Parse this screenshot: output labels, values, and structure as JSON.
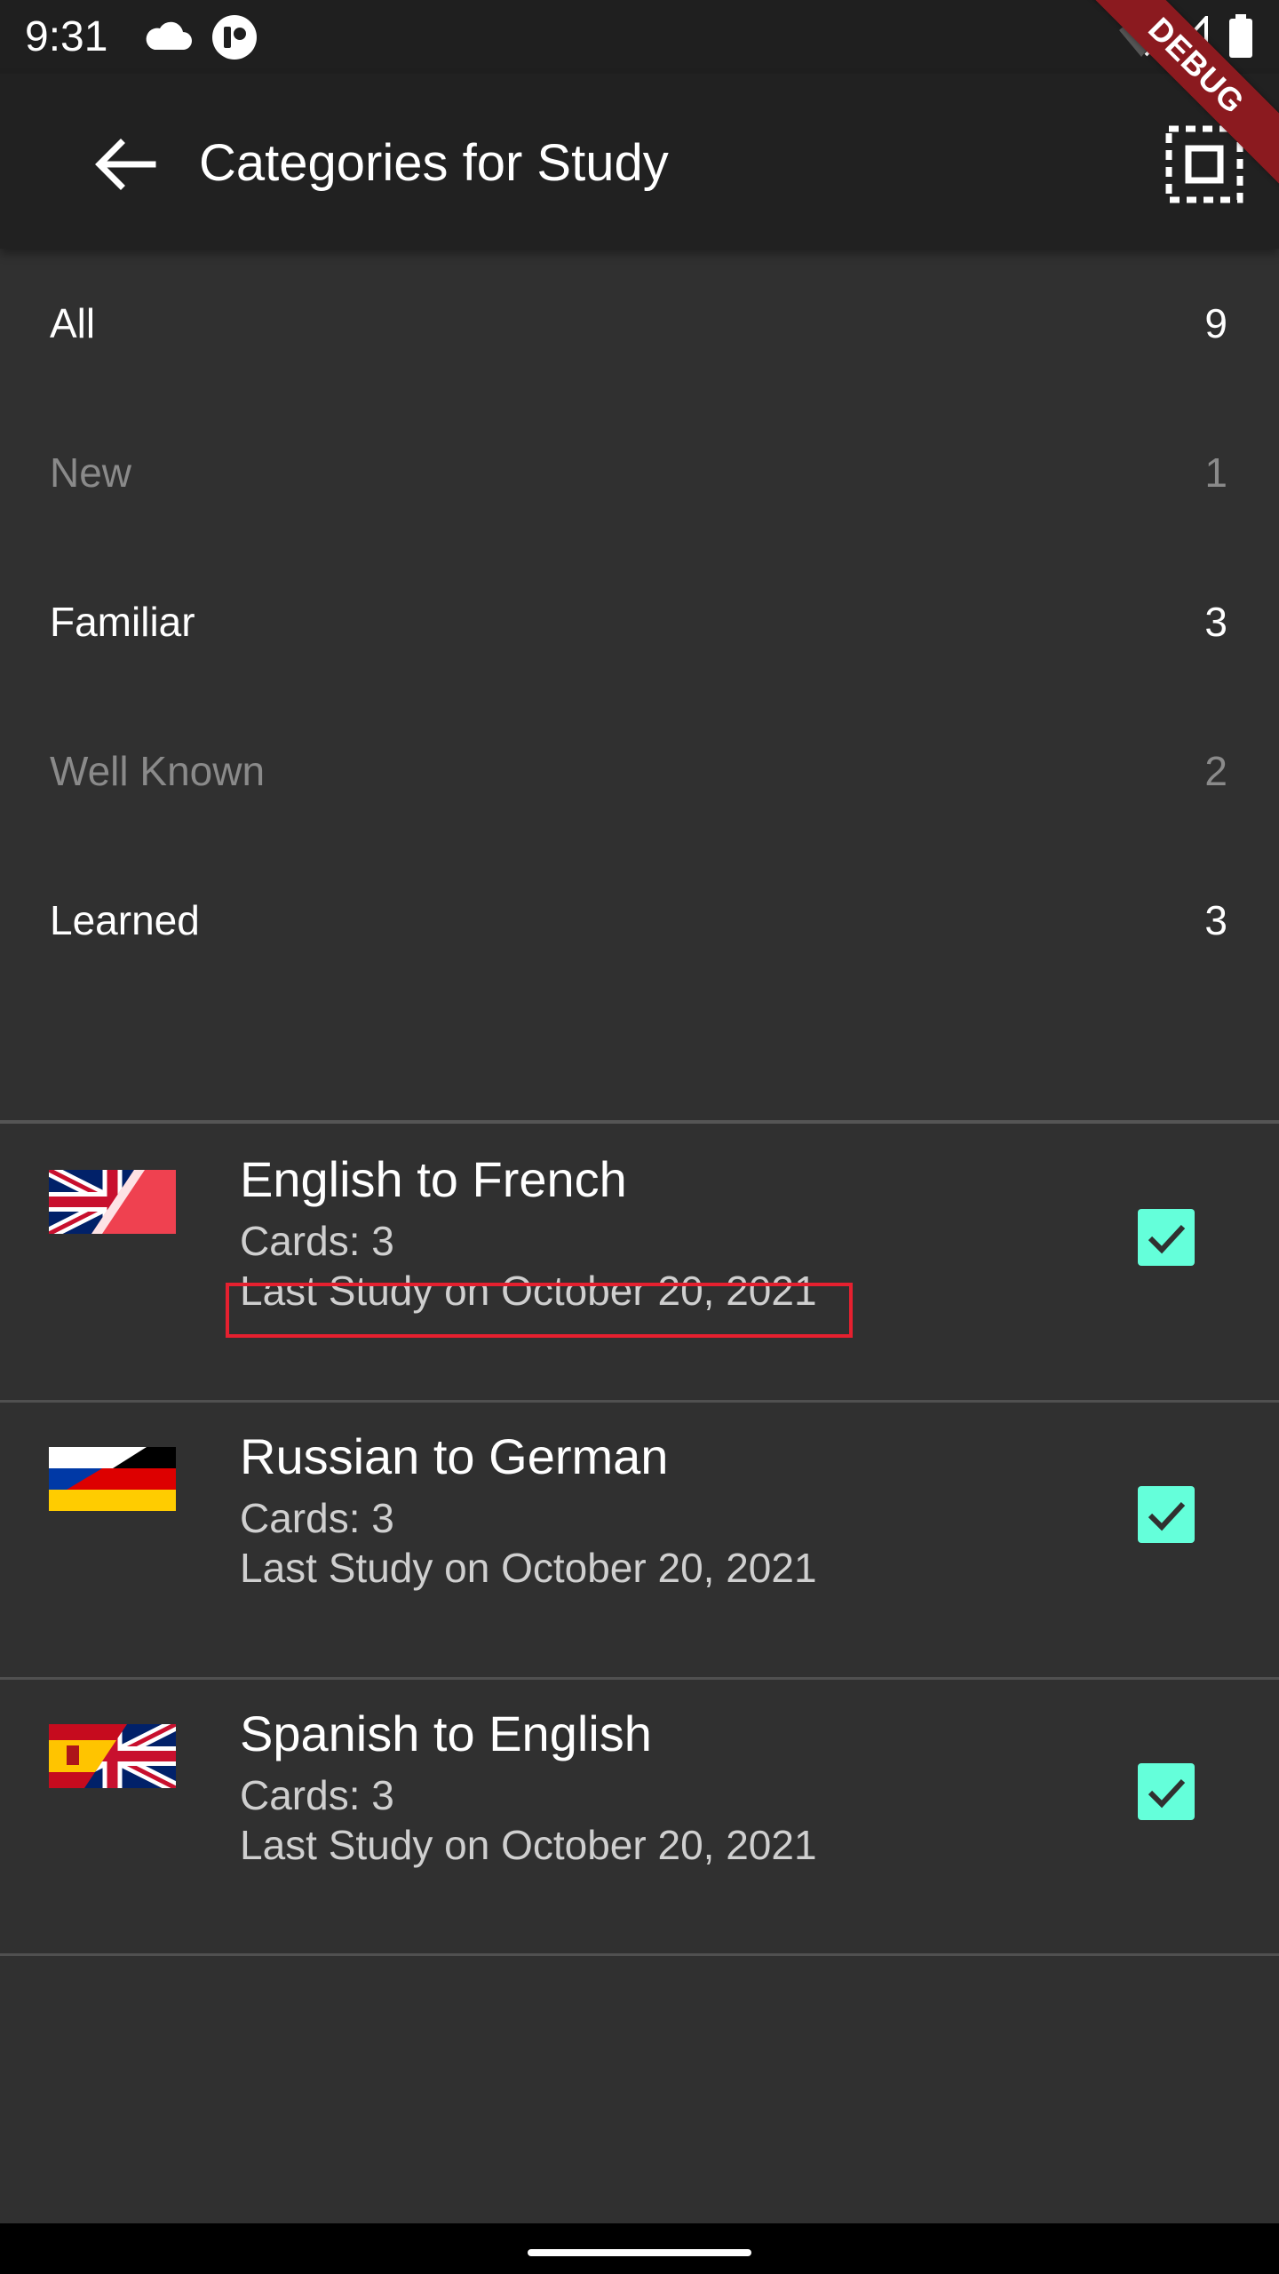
{
  "status_bar": {
    "time": "9:31"
  },
  "debug_banner": "DEBUG",
  "app_bar": {
    "title": "Categories for Study"
  },
  "stats": [
    {
      "label": "All",
      "count": "9",
      "style": "bright"
    },
    {
      "label": "New",
      "count": "1",
      "style": "dim"
    },
    {
      "label": "Familiar",
      "count": "3",
      "style": "bright"
    },
    {
      "label": "Well Known",
      "count": "2",
      "style": "dim"
    },
    {
      "label": "Learned",
      "count": "3",
      "style": "bright"
    }
  ],
  "categories": [
    {
      "title": "English to French",
      "cards": "Cards: 3",
      "last_study": "Last Study on October 20, 2021",
      "checked": true,
      "flag": "uk-france-flag"
    },
    {
      "title": "Russian to German",
      "cards": "Cards: 3",
      "last_study": "Last Study on October 20, 2021",
      "checked": true,
      "flag": "russia-germany-flag"
    },
    {
      "title": "Spanish to English",
      "cards": "Cards: 3",
      "last_study": "Last Study on October 20, 2021",
      "checked": true,
      "flag": "spain-uk-flag"
    }
  ],
  "colors": {
    "accent": "#64ffda",
    "background": "#303030",
    "app_bar": "#212121",
    "highlight": "#e5202f"
  }
}
